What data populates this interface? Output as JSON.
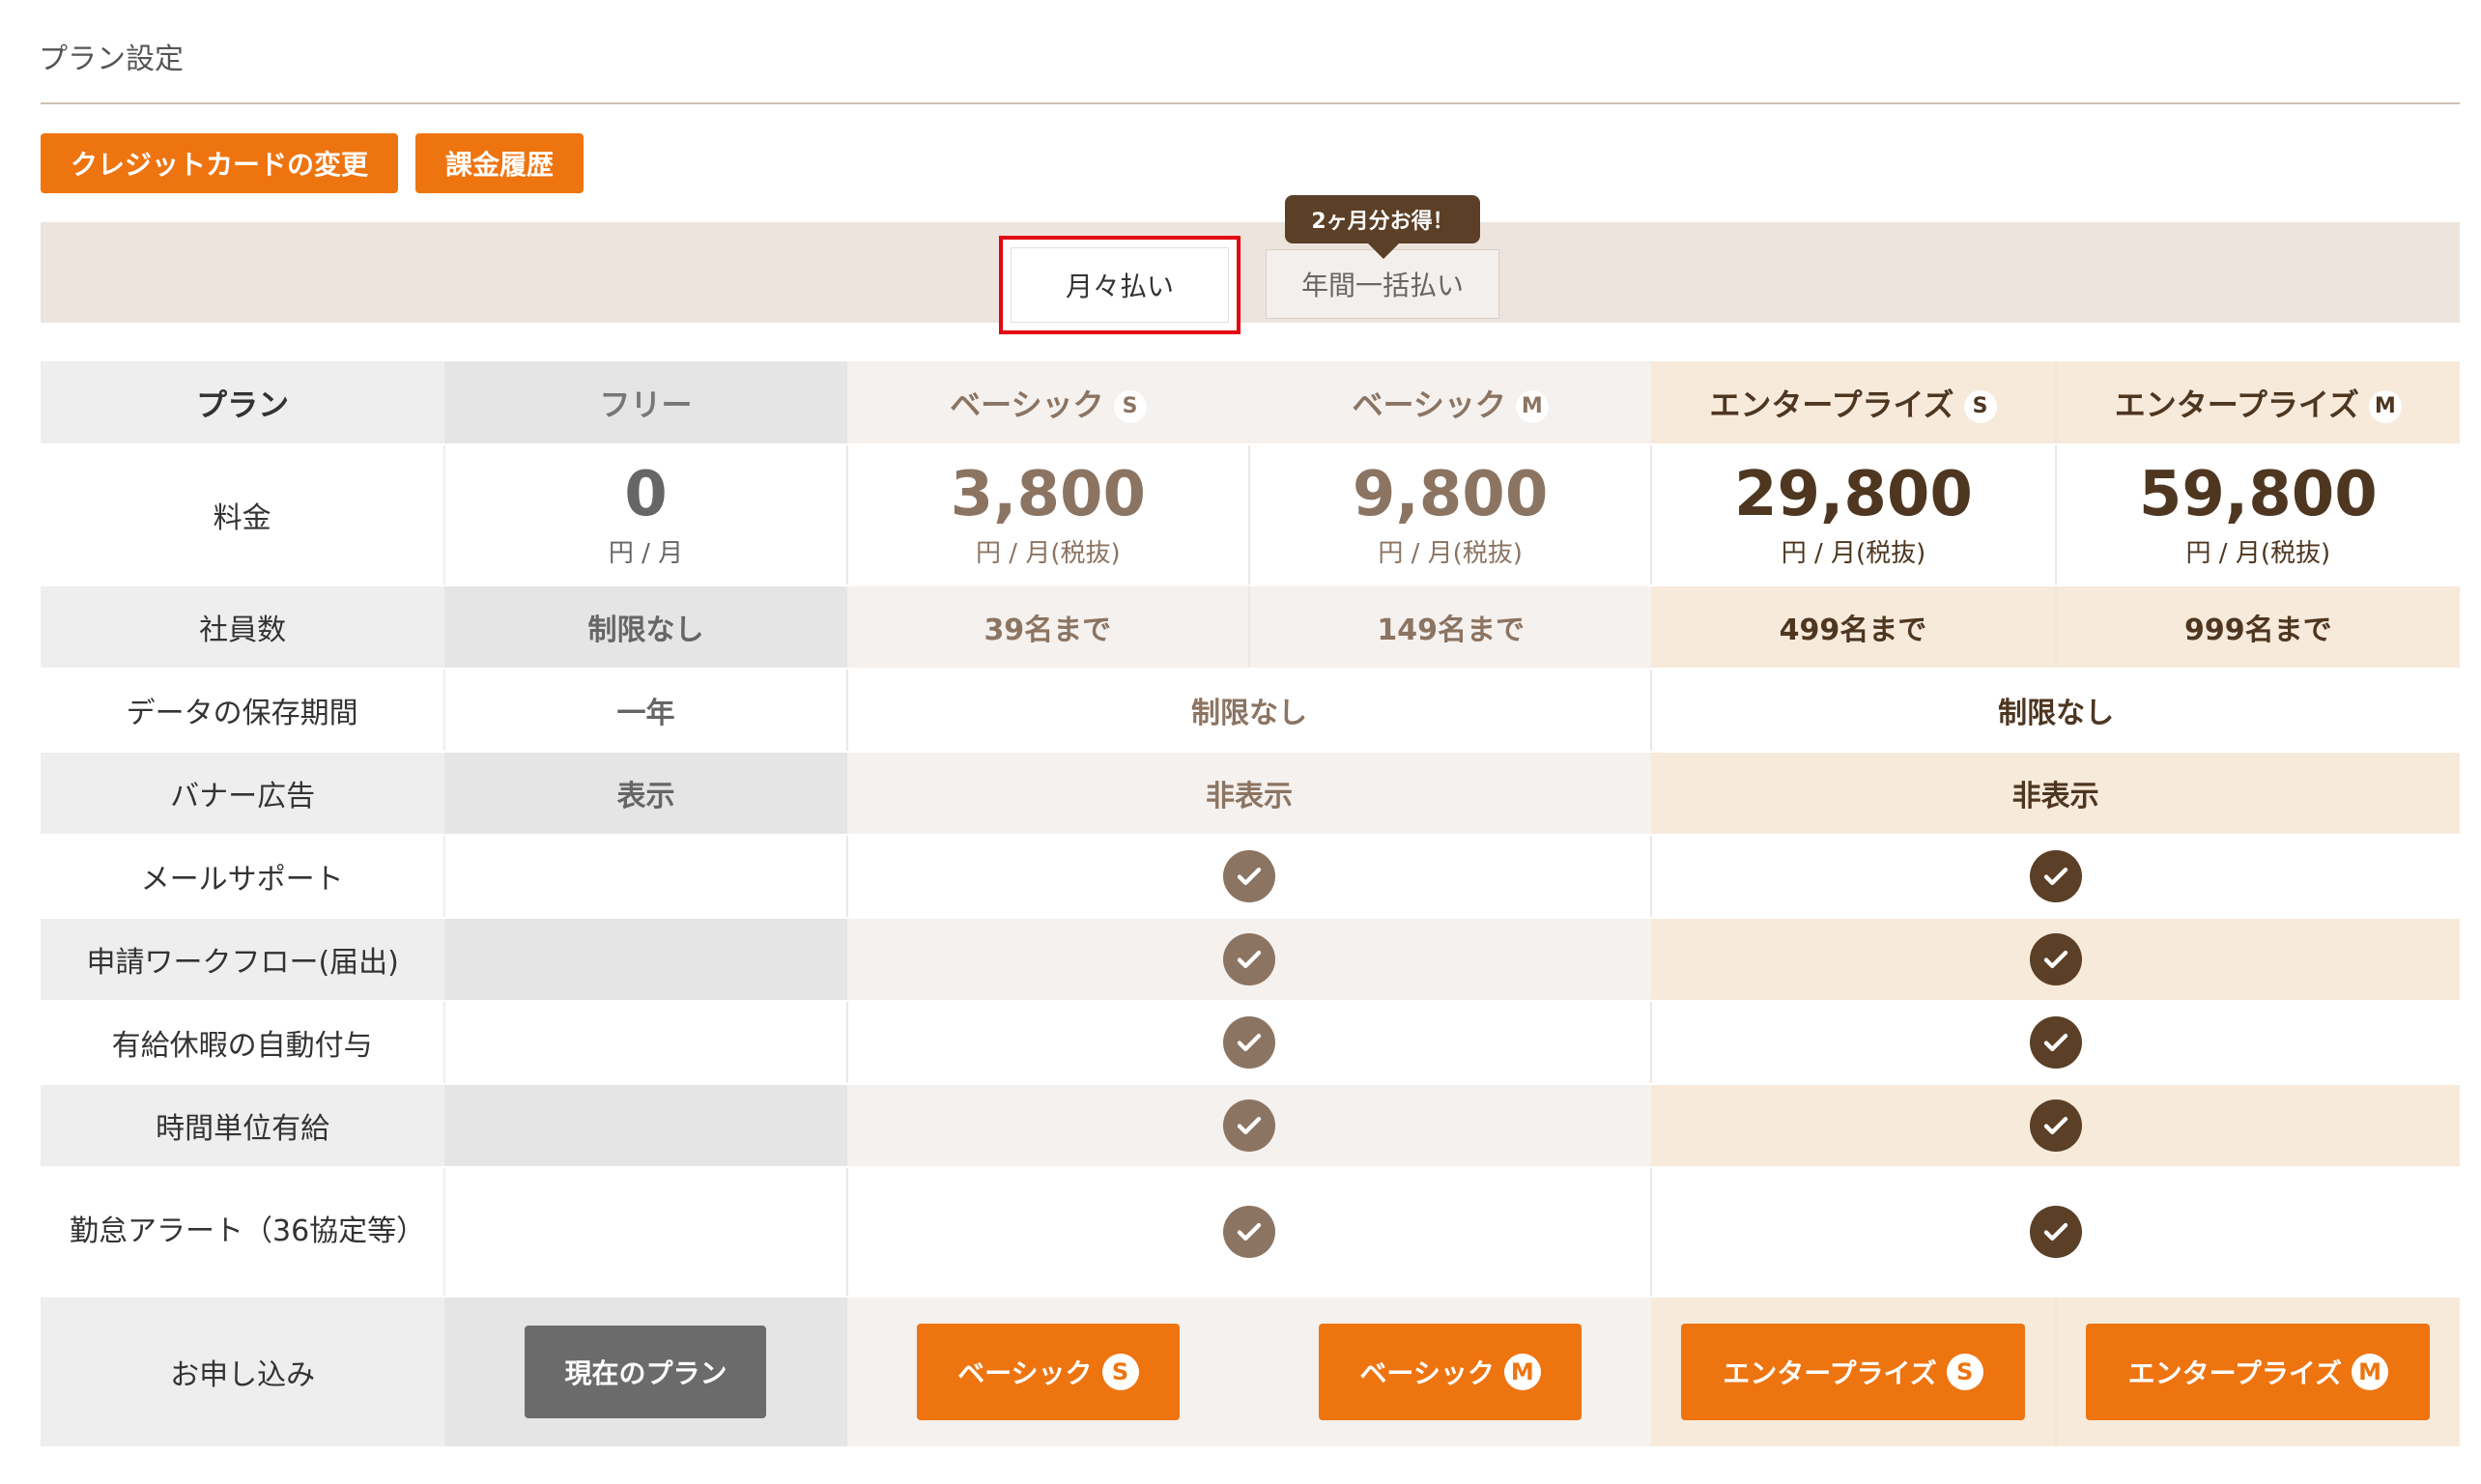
{
  "page": {
    "title": "プラン設定",
    "card_button": "クレジットカードの変更",
    "history_button": "課金履歴"
  },
  "tabs": {
    "monthly": "月々払い",
    "yearly": "年間一括払い",
    "promo": "2ヶ月分お得！"
  },
  "table": {
    "header_label": "プラン",
    "plans": {
      "free": {
        "name": "フリー",
        "badge": ""
      },
      "basic_s": {
        "name": "ベーシック",
        "badge": "S"
      },
      "basic_m": {
        "name": "ベーシック",
        "badge": "M"
      },
      "ent_s": {
        "name": "エンタープライズ",
        "badge": "S"
      },
      "ent_m": {
        "name": "エンタープライズ",
        "badge": "M"
      }
    },
    "rows": {
      "price": "料金",
      "employees": "社員数",
      "retention": "データの保存期間",
      "banner": "バナー広告",
      "mail_support": "メールサポート",
      "workflow": "申請ワークフロー(届出)",
      "paid_leave": "有給休暇の自動付与",
      "hourly_leave": "時間単位有給",
      "alert": "勤怠アラート（36協定等）",
      "apply": "お申し込み"
    },
    "price": {
      "free": {
        "amount": "0",
        "unit": "円 / 月"
      },
      "basic_s": {
        "amount": "3,800",
        "unit": "円 / 月(税抜)"
      },
      "basic_m": {
        "amount": "9,800",
        "unit": "円 / 月(税抜)"
      },
      "ent_s": {
        "amount": "29,800",
        "unit": "円 / 月(税抜)"
      },
      "ent_m": {
        "amount": "59,800",
        "unit": "円 / 月(税抜)"
      }
    },
    "employees": {
      "free": "制限なし",
      "basic_s": "39名まで",
      "basic_m": "149名まで",
      "ent_s": "499名まで",
      "ent_m": "999名まで"
    },
    "retention": {
      "free": "一年",
      "basic": "制限なし",
      "ent": "制限なし"
    },
    "banner": {
      "free": "表示",
      "basic": "非表示",
      "ent": "非表示"
    },
    "apply": {
      "free": "現在のプラン",
      "basic_s": "ベーシック",
      "basic_m": "ベーシック",
      "ent_s": "エンタープライズ",
      "ent_m": "エンタープライズ",
      "badge_s": "S",
      "badge_m": "M"
    }
  },
  "colors": {
    "accent": "#ee7410",
    "basic": "#8c7462",
    "enterprise": "#5b3f26",
    "highlight": "#e30613"
  }
}
